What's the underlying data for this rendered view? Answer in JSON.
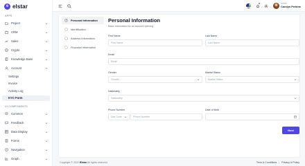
{
  "brand": {
    "name": "elstar",
    "logo_letter": "e"
  },
  "sidebar": {
    "apps_section": "APPS",
    "ui_section": "UI COMPONENTS",
    "apps": [
      {
        "label": "Project",
        "icon": "folder-icon"
      },
      {
        "label": "CRM",
        "icon": "briefcase-icon"
      },
      {
        "label": "Sales",
        "icon": "trending-icon"
      },
      {
        "label": "Crypto",
        "icon": "crypto-icon"
      },
      {
        "label": "Knowledge Base",
        "icon": "book-icon"
      },
      {
        "label": "Account",
        "icon": "user-icon"
      }
    ],
    "account_sub": [
      {
        "label": "Settings"
      },
      {
        "label": "Invoice"
      },
      {
        "label": "Activity Log"
      },
      {
        "label": "KYC Form"
      }
    ],
    "components": [
      {
        "label": "Common",
        "icon": "layers-icon"
      },
      {
        "label": "Feedback",
        "icon": "chat-icon"
      },
      {
        "label": "Data Display",
        "icon": "table-icon"
      },
      {
        "label": "Forms",
        "icon": "form-icon"
      },
      {
        "label": "Navigation",
        "icon": "compass-icon"
      },
      {
        "label": "Graph",
        "icon": "graph-icon"
      }
    ]
  },
  "topbar": {
    "user_role": "Admin",
    "user_name": "Carolyn Perkins"
  },
  "steps": [
    {
      "label": "Personal Information"
    },
    {
      "label": "Identification"
    },
    {
      "label": "Address Information"
    },
    {
      "label": "Financial Information"
    }
  ],
  "form": {
    "title": "Personal Information",
    "subtitle": "Basic information for an account opening",
    "first_name": {
      "label": "First Name",
      "placeholder": "First Name"
    },
    "last_name": {
      "label": "Last Name",
      "placeholder": "Last Name"
    },
    "email": {
      "label": "Email",
      "placeholder": "Email"
    },
    "gender": {
      "label": "Gender",
      "placeholder": "Gender"
    },
    "marital": {
      "label": "Marital Status",
      "placeholder": "Marital Status"
    },
    "nationality": {
      "label": "Nationality",
      "placeholder": "Nationality"
    },
    "phone": {
      "label": "Phone Number",
      "dial_placeholder": "Dial Code",
      "number_placeholder": "Phone Number"
    },
    "dob": {
      "label": "Date of Birth",
      "placeholder": ""
    },
    "next_label": "Next"
  },
  "footer": {
    "copyright_pre": "Copyright © 2022",
    "copyright_brand": "Elstar",
    "copyright_post": "All rights reserved.",
    "terms": "Term & Conditions",
    "separator": "|",
    "privacy": "Privacy & Policy"
  }
}
